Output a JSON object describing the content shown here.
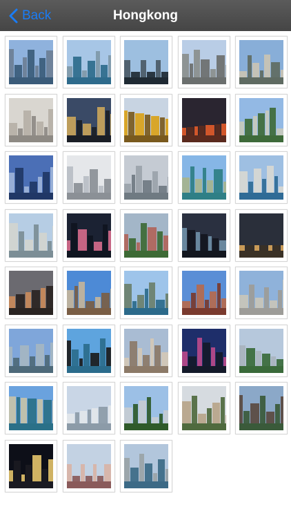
{
  "navbar": {
    "back_label": "Back",
    "title": "Hongkong",
    "back_color": "#1a7cf5"
  },
  "photos": [
    {
      "icon": "skyline-photo-icon",
      "sky": "#8fb2dd",
      "ground": "#3b5c7a",
      "accent": "#6c7f95"
    },
    {
      "icon": "harbour-photo-icon",
      "sky": "#a7c6e6",
      "ground": "#2e6b8c",
      "accent": "#7f98a8"
    },
    {
      "icon": "tower-photo-icon",
      "sky": "#9dbfe0",
      "ground": "#1f2a33",
      "accent": "#4b5a66"
    },
    {
      "icon": "building-photo-icon",
      "sky": "#b9cde6",
      "ground": "#6b6f6e",
      "accent": "#8a8f8d"
    },
    {
      "icon": "skyline-photo-icon",
      "sky": "#88aed8",
      "ground": "#5f6b62",
      "accent": "#c9c3b4"
    },
    {
      "icon": "tower-photo-icon",
      "sky": "#d9d6d0",
      "ground": "#8e8a84",
      "accent": "#b6b0a6"
    },
    {
      "icon": "night-city-photo-icon",
      "sky": "#3a4a66",
      "ground": "#1b1f26",
      "accent": "#c9a45a"
    },
    {
      "icon": "golden-bauhinia-photo-icon",
      "sky": "#c8d4e2",
      "ground": "#7a5a1e",
      "accent": "#d9a21a"
    },
    {
      "icon": "night-street-photo-icon",
      "sky": "#2a2530",
      "ground": "#5a2a1e",
      "accent": "#e05a2a"
    },
    {
      "icon": "residential-photo-icon",
      "sky": "#93b9e4",
      "ground": "#3e6a3a",
      "accent": "#c7c9bd"
    },
    {
      "icon": "tower-photo-icon",
      "sky": "#4b6fb6",
      "ground": "#203766",
      "accent": "#9db3d9"
    },
    {
      "icon": "building-photo-icon",
      "sky": "#e5e7ea",
      "ground": "#8b9096",
      "accent": "#b9bec4"
    },
    {
      "icon": "harbour-photo-icon",
      "sky": "#c5cbd3",
      "ground": "#6f7a82",
      "accent": "#9aa3aa"
    },
    {
      "icon": "waterfront-photo-icon",
      "sky": "#86b6e6",
      "ground": "#2f7f86",
      "accent": "#a7b48e"
    },
    {
      "icon": "ferry-photo-icon",
      "sky": "#9ebfe2",
      "ground": "#2f6b96",
      "accent": "#d8d8d2"
    },
    {
      "icon": "skyline-photo-icon",
      "sky": "#b6cde4",
      "ground": "#7c8e96",
      "accent": "#d2d5cf"
    },
    {
      "icon": "night-city-photo-icon",
      "sky": "#1b2233",
      "ground": "#0f1520",
      "accent": "#d46a8a"
    },
    {
      "icon": "residential-photo-icon",
      "sky": "#a3b6c8",
      "ground": "#3d6a35",
      "accent": "#b0655a"
    },
    {
      "icon": "night-city-photo-icon",
      "sky": "#2a3040",
      "ground": "#13171f",
      "accent": "#6f8fa6"
    },
    {
      "icon": "clock-tower-photo-icon",
      "sky": "#2a2f3a",
      "ground": "#3a3126",
      "accent": "#d6a45a"
    },
    {
      "icon": "night-city-photo-icon",
      "sky": "#6b6a70",
      "ground": "#2a2422",
      "accent": "#c98a5a"
    },
    {
      "icon": "hotel-photo-icon",
      "sky": "#4d8ad6",
      "ground": "#7a5e45",
      "accent": "#c4b49a"
    },
    {
      "icon": "harbour-photo-icon",
      "sky": "#9ec4ea",
      "ground": "#2c6a8a",
      "accent": "#6b7f6b"
    },
    {
      "icon": "tower-photo-icon",
      "sky": "#5a8ed6",
      "ground": "#7a3a2e",
      "accent": "#b56a4e"
    },
    {
      "icon": "monument-photo-icon",
      "sky": "#8fb2da",
      "ground": "#9d9c98",
      "accent": "#c9c5ba"
    },
    {
      "icon": "tower-photo-icon",
      "sky": "#7fa6da",
      "ground": "#4e6a7a",
      "accent": "#a5b6c2"
    },
    {
      "icon": "statue-photo-icon",
      "sky": "#5ea4de",
      "ground": "#2b6c8c",
      "accent": "#1b1b1b"
    },
    {
      "icon": "building-photo-icon",
      "sky": "#a9bcd3",
      "ground": "#8c7a68",
      "accent": "#d4c8b6"
    },
    {
      "icon": "night-city-photo-icon",
      "sky": "#1e2e6a",
      "ground": "#141a2a",
      "accent": "#b84a8a"
    },
    {
      "icon": "tower-photo-icon",
      "sky": "#b6c8dc",
      "ground": "#3a6a3a",
      "accent": "#a9b3bd"
    },
    {
      "icon": "harbour-photo-icon",
      "sky": "#6aa2de",
      "ground": "#2a7088",
      "accent": "#c7c2a8"
    },
    {
      "icon": "tower-photo-icon",
      "sky": "#c9d6e6",
      "ground": "#8c9ba8",
      "accent": "#e2e6ea"
    },
    {
      "icon": "palm-tower-photo-icon",
      "sky": "#9cc0e6",
      "ground": "#2f5a2a",
      "accent": "#c6ccd2"
    },
    {
      "icon": "skyline-photo-icon",
      "sky": "#d6dbe0",
      "ground": "#4f6a3e",
      "accent": "#b7a58a"
    },
    {
      "icon": "building-photo-icon",
      "sky": "#8ba8c8",
      "ground": "#3a5a3a",
      "accent": "#5a4a40"
    },
    {
      "icon": "night-city-photo-icon",
      "sky": "#0d0f18",
      "ground": "#1a1a22",
      "accent": "#e0c06a"
    },
    {
      "icon": "residential-photo-icon",
      "sky": "#c3d2e3",
      "ground": "#8a5a5a",
      "accent": "#d9b3a6"
    },
    {
      "icon": "harbour-photo-icon",
      "sky": "#b2c6dc",
      "ground": "#3c6a86",
      "accent": "#9aa3a6"
    }
  ]
}
